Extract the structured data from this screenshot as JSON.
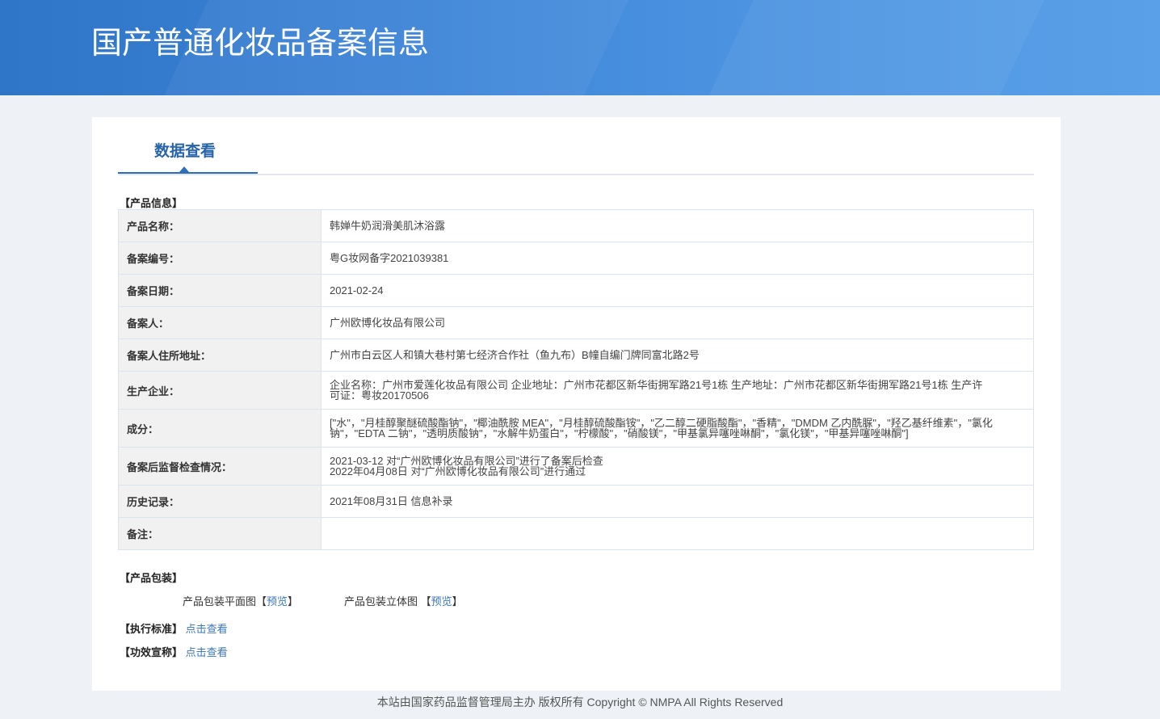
{
  "banner": {
    "title": "国产普通化妆品备案信息"
  },
  "tab": {
    "label": "数据查看"
  },
  "sections": {
    "product_info": "【产品信息】",
    "packaging": "【产品包装】",
    "standard": "【执行标准】",
    "efficacy": "【功效宣称】"
  },
  "info_rows": [
    {
      "key": "产品名称：",
      "value": "韩婵牛奶润滑美肌沐浴露"
    },
    {
      "key": "备案编号：",
      "value": "粤G妆网备字2021039381"
    },
    {
      "key": "备案日期：",
      "value": "2021-02-24"
    },
    {
      "key": "备案人：",
      "value": "广州欧博化妆品有限公司"
    },
    {
      "key": "备案人住所地址：",
      "value": "广州市白云区人和镇大巷村第七经济合作社（鱼九布）B幢自编门牌同富北路2号"
    },
    {
      "key": "生产企业：",
      "value": "企业名称：广州市爱莲化妆品有限公司 企业地址：广州市花都区新华街拥军路21号1栋 生产地址：广州市花都区新华街拥军路21号1栋 生产许可证：粤妆20170506"
    },
    {
      "key": "成分：",
      "value": "[\"水\"，\"月桂醇聚醚硫酸酯钠\"，\"椰油酰胺 MEA\"，\"月桂醇硫酸酯铵\"，\"乙二醇二硬脂酸酯\"，\"香精\"，\"DMDM 乙内酰脲\"，\"羟乙基纤维素\"，\"氯化钠\"，\"EDTA 二钠\"，\"透明质酸钠\"，\"水解牛奶蛋白\"，\"柠檬酸\"，\"硝酸镁\"，\"甲基氯异噻唑啉酮\"，\"氯化镁\"，\"甲基异噻唑啉酮\"]"
    },
    {
      "key": "备案后监督检查情况：",
      "value_lines": [
        "2021-03-12 对“广州欧博化妆品有限公司”进行了备案后检查",
        "2022年04月08日 对“广州欧博化妆品有限公司”进行通过"
      ]
    },
    {
      "key": "历史记录：",
      "value": "2021年08月31日 信息补录"
    },
    {
      "key": "备注：",
      "value": ""
    }
  ],
  "packaging": {
    "flat_label": "产品包装平面图",
    "solid_label": "产品包装立体图",
    "preview_label": "预览",
    "bracket_open": "【",
    "bracket_close": "】"
  },
  "links": {
    "standard": "点击查看",
    "efficacy": "点击查看"
  },
  "footer": {
    "text": "本站由国家药品监督管理局主办 版权所有 Copyright © NMPA All Rights Reserved"
  }
}
